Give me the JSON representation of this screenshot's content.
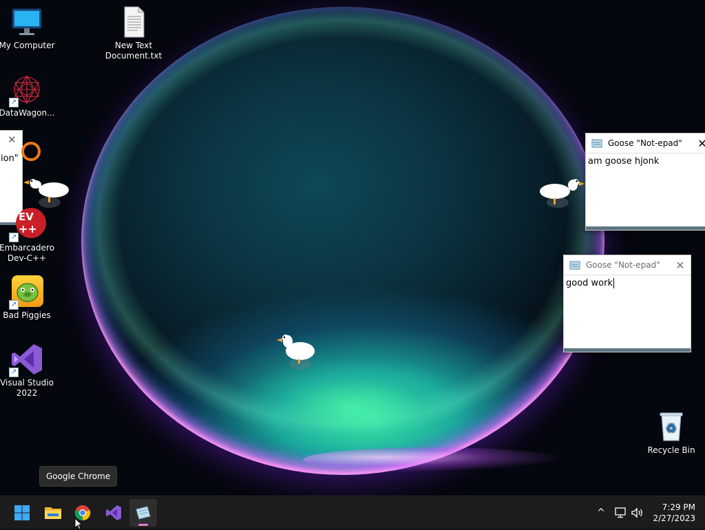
{
  "desktop": {
    "icons": [
      {
        "label": "My Computer",
        "icon": "monitor-icon"
      },
      {
        "label": "New Text Document.txt",
        "icon": "text-document-icon"
      },
      {
        "label": "DataWagon...",
        "icon": "datawagon-icon"
      },
      {
        "label": "Embarcadero Dev-C++",
        "icon": "devcpp-icon",
        "badge_text": "EV"
      },
      {
        "label": "Bad Piggies",
        "icon": "bad-piggies-icon"
      },
      {
        "label": "Visual Studio 2022",
        "icon": "visual-studio-icon"
      },
      {
        "label": "Recycle Bin",
        "icon": "recycle-bin-icon"
      }
    ],
    "partial_window_text": "ion\"",
    "shortcut_glyph": "↗"
  },
  "windows": [
    {
      "title": "Goose \"Not-epad\"",
      "content": "am goose hjonk",
      "close_glyph": "✕",
      "focused": true
    },
    {
      "title": "Goose \"Not-epad\"",
      "content": "good work",
      "close_glyph": "✕",
      "focused": false
    }
  ],
  "tooltip": {
    "text": "Google Chrome"
  },
  "taskbar": {
    "apps": [
      {
        "name": "Start",
        "icon": "windows-start-icon"
      },
      {
        "name": "File Explorer",
        "icon": "folder-icon"
      },
      {
        "name": "Google Chrome",
        "icon": "chrome-icon"
      },
      {
        "name": "Visual Studio",
        "icon": "visual-studio-icon"
      },
      {
        "name": "Goose Not-epad",
        "icon": "notepad-icon",
        "active": true
      }
    ],
    "tray": {
      "chevron": "^",
      "icons": [
        "network-icon",
        "volume-icon"
      ]
    },
    "clock": {
      "time": "7:29 PM",
      "date": "2/27/2023"
    }
  },
  "colors": {
    "taskbar": "#1c1c1c",
    "accent": "#e57bd1",
    "window_bottom_bar": "#5d7584"
  }
}
